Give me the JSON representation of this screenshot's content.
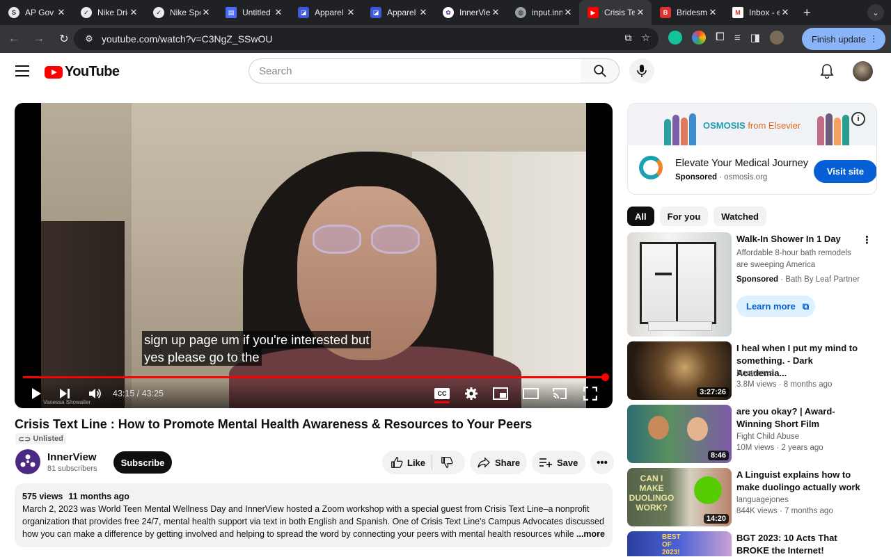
{
  "browser": {
    "tabs": [
      {
        "title": "AP Gov |",
        "icon": "S"
      },
      {
        "title": "Nike Dri-",
        "icon": "nike"
      },
      {
        "title": "Nike Spo",
        "icon": "nike"
      },
      {
        "title": "Untitled",
        "icon": "doc"
      },
      {
        "title": "Apparel",
        "icon": "apparel"
      },
      {
        "title": "Apparel",
        "icon": "apparel"
      },
      {
        "title": "InnerVie",
        "icon": "innerview"
      },
      {
        "title": "input.inn",
        "icon": "globe"
      },
      {
        "title": "Crisis Te",
        "icon": "youtube"
      },
      {
        "title": "Bridesm",
        "icon": "bride"
      },
      {
        "title": "Inbox - e",
        "icon": "gmail"
      }
    ],
    "url": "youtube.com/watch?v=C3NgZ_SSwOU",
    "finish_update": "Finish update"
  },
  "header": {
    "logo_text": "YouTube",
    "search_placeholder": "Search"
  },
  "player": {
    "caption_line1": "sign up page um if you're interested but",
    "caption_line2": "yes please go to the",
    "time": "43:15 / 43:25",
    "watermark": "Vanessa Showalter",
    "progress_fraction": 0.996,
    "cc": "CC"
  },
  "video": {
    "title": "Crisis Text Line : How to Promote Mental Health Awareness & Resources to Your Peers",
    "visibility": "Unlisted",
    "channel_name": "InnerView",
    "channel_subs": "81 subscribers",
    "subscribe": "Subscribe",
    "like": "Like",
    "share": "Share",
    "save": "Save",
    "views": "575 views",
    "age": "11 months ago",
    "description": "March 2, 2023 was World Teen Mental Wellness Day and InnerView hosted a Zoom workshop with a special guest from Crisis Text Line–a nonprofit organization that provides free 24/7, mental health support via text in both English and Spanish. One of Crisis Text Line's Campus Advocates discussed how you can make a difference by getting involved and helping to spread the word by connecting your peers with mental health resources while t",
    "more": "...more"
  },
  "ad": {
    "brand": "OSMOSIS",
    "brand_from": "from Elsevier",
    "title": "Elevate Your Medical Journey",
    "sponsored": "Sponsored",
    "domain": "osmosis.org",
    "cta": "Visit site"
  },
  "chips": [
    "All",
    "For you",
    "Watched"
  ],
  "recommendations": [
    {
      "title": "Walk-In Shower In 1 Day",
      "desc": "Affordable 8-hour bath remodels are sweeping America",
      "sponsored": "Sponsored",
      "advertiser": "Bath By Leaf Partner",
      "cta": "Learn more"
    },
    {
      "title": "I heal when I put my mind to something. - Dark Academia...",
      "channel": "Nocturnes",
      "meta": "3.8M views · 8 months ago",
      "duration": "3:27:26"
    },
    {
      "title": "are you okay? | Award-Winning Short Film",
      "channel": "Fight Child Abuse",
      "meta": "10M views · 2 years ago",
      "duration": "8:46"
    },
    {
      "title": "A Linguist explains how to make duolingo actually work",
      "channel": "languagejones",
      "meta": "844K views · 7 months ago",
      "duration": "14:20",
      "thumb_text": "CAN I MAKE DUOLINGO WORK?"
    },
    {
      "title": "BGT 2023: 10 Acts That BROKE the Internet!",
      "thumb_text": "BEST OF 2023!"
    }
  ]
}
